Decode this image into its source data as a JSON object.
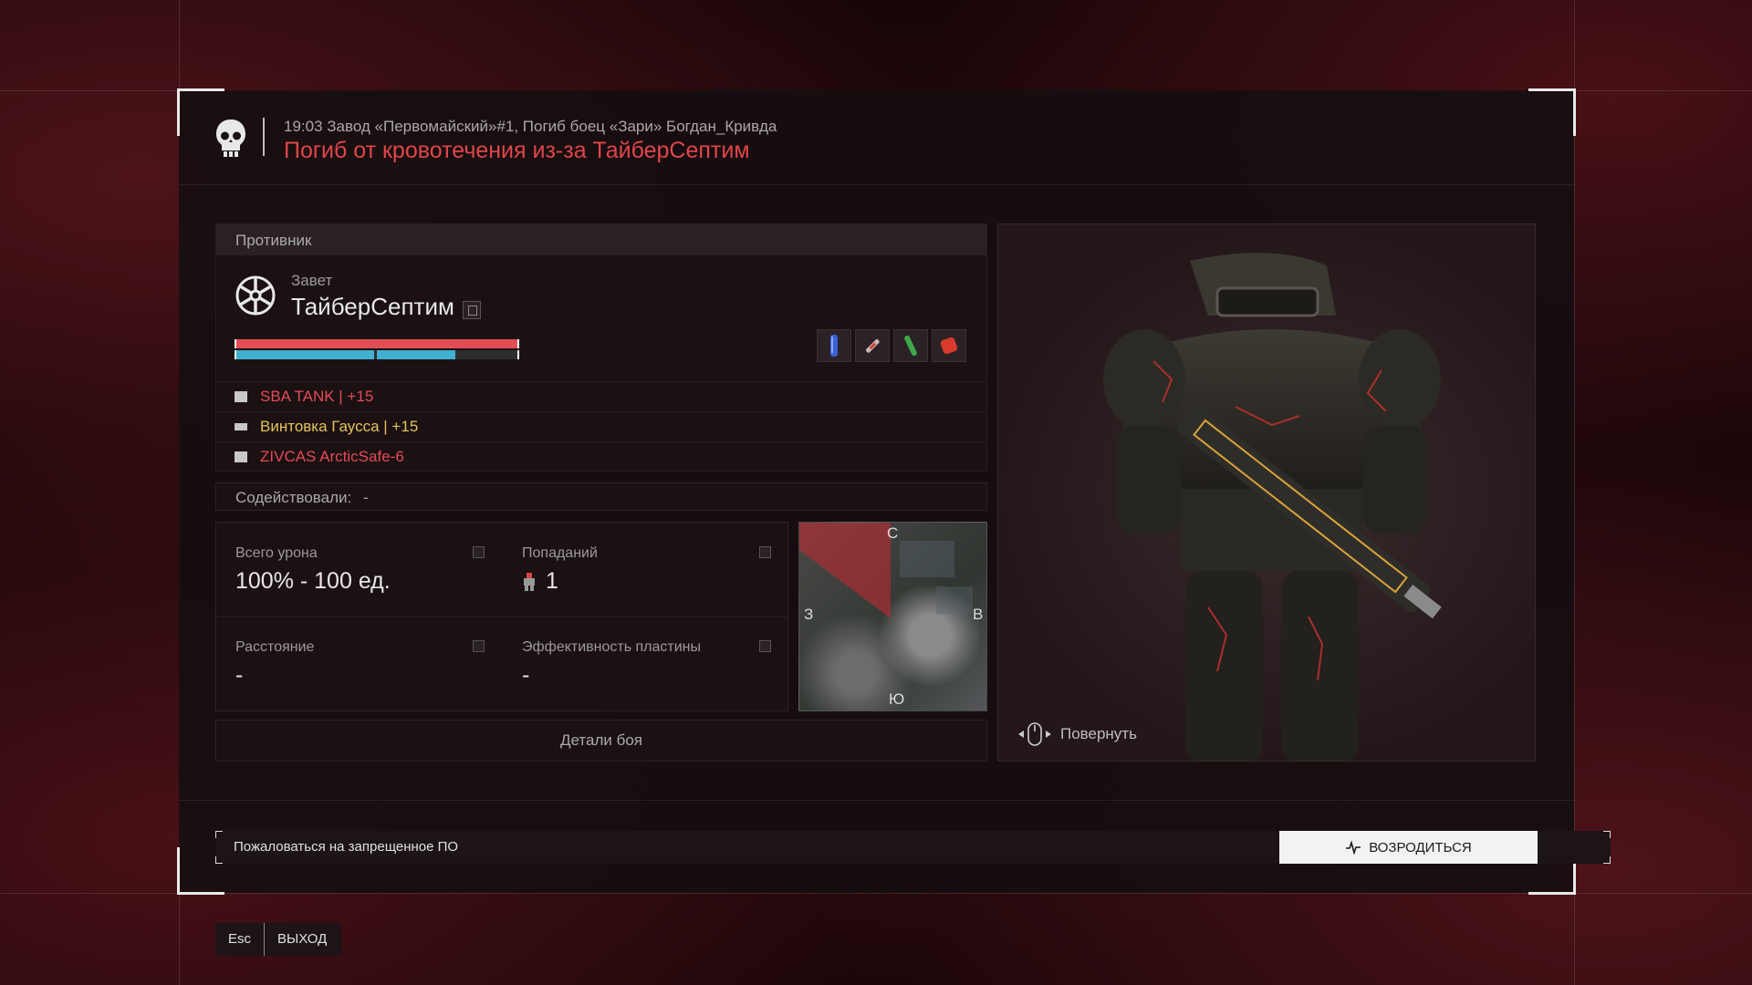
{
  "header": {
    "subtitle": "19:03 Завод «Первомайский»#1, Погиб боец «Зари» Богдан_Кривда",
    "title": "Погиб от кровотечения из-за ТайберСептим"
  },
  "enemy": {
    "section_label": "Противник",
    "faction": "Завет",
    "name": "ТайберСептим",
    "health_fraction": 1.0,
    "armor_segments": [
      0.49,
      0.28
    ],
    "gear": [
      {
        "icon": "helmet-icon",
        "label": "SBA TANK | +15",
        "color": "#e24c55"
      },
      {
        "icon": "rifle-icon",
        "label": "Винтовка Гаусса | +15",
        "color": "#e3c35a"
      },
      {
        "icon": "armor-icon",
        "label": "ZIVCAS ArcticSafe-6",
        "color": "#e24c55"
      }
    ],
    "consumables": [
      "blue-vial-icon",
      "syringe-icon",
      "green-vial-icon",
      "medkit-icon"
    ]
  },
  "assist": {
    "label": "Содействовали:",
    "value": "-"
  },
  "stats": {
    "total_damage_label": "Всего урона",
    "total_damage_value": "100% - 100 ед.",
    "hits_label": "Попаданий",
    "hits_value": "1",
    "distance_label": "Расстояние",
    "distance_value": "-",
    "plate_eff_label": "Эффективность пластины",
    "plate_eff_value": "-"
  },
  "minimap": {
    "north": "С",
    "south": "Ю",
    "west": "З",
    "east": "В"
  },
  "details_button": "Детали боя",
  "model": {
    "rotate_label": "Повернуть"
  },
  "footer": {
    "report_button": "Пожаловаться на запрещенное ПО",
    "respawn_button": "ВОЗРОДИТЬСЯ",
    "esc_key": "Esc",
    "exit_label": "ВЫХОД"
  },
  "colors": {
    "accent_red": "#e0464a",
    "health_red": "#e24c55",
    "armor_blue": "#3fb0cf",
    "weapon_yellow": "#e3c35a"
  }
}
